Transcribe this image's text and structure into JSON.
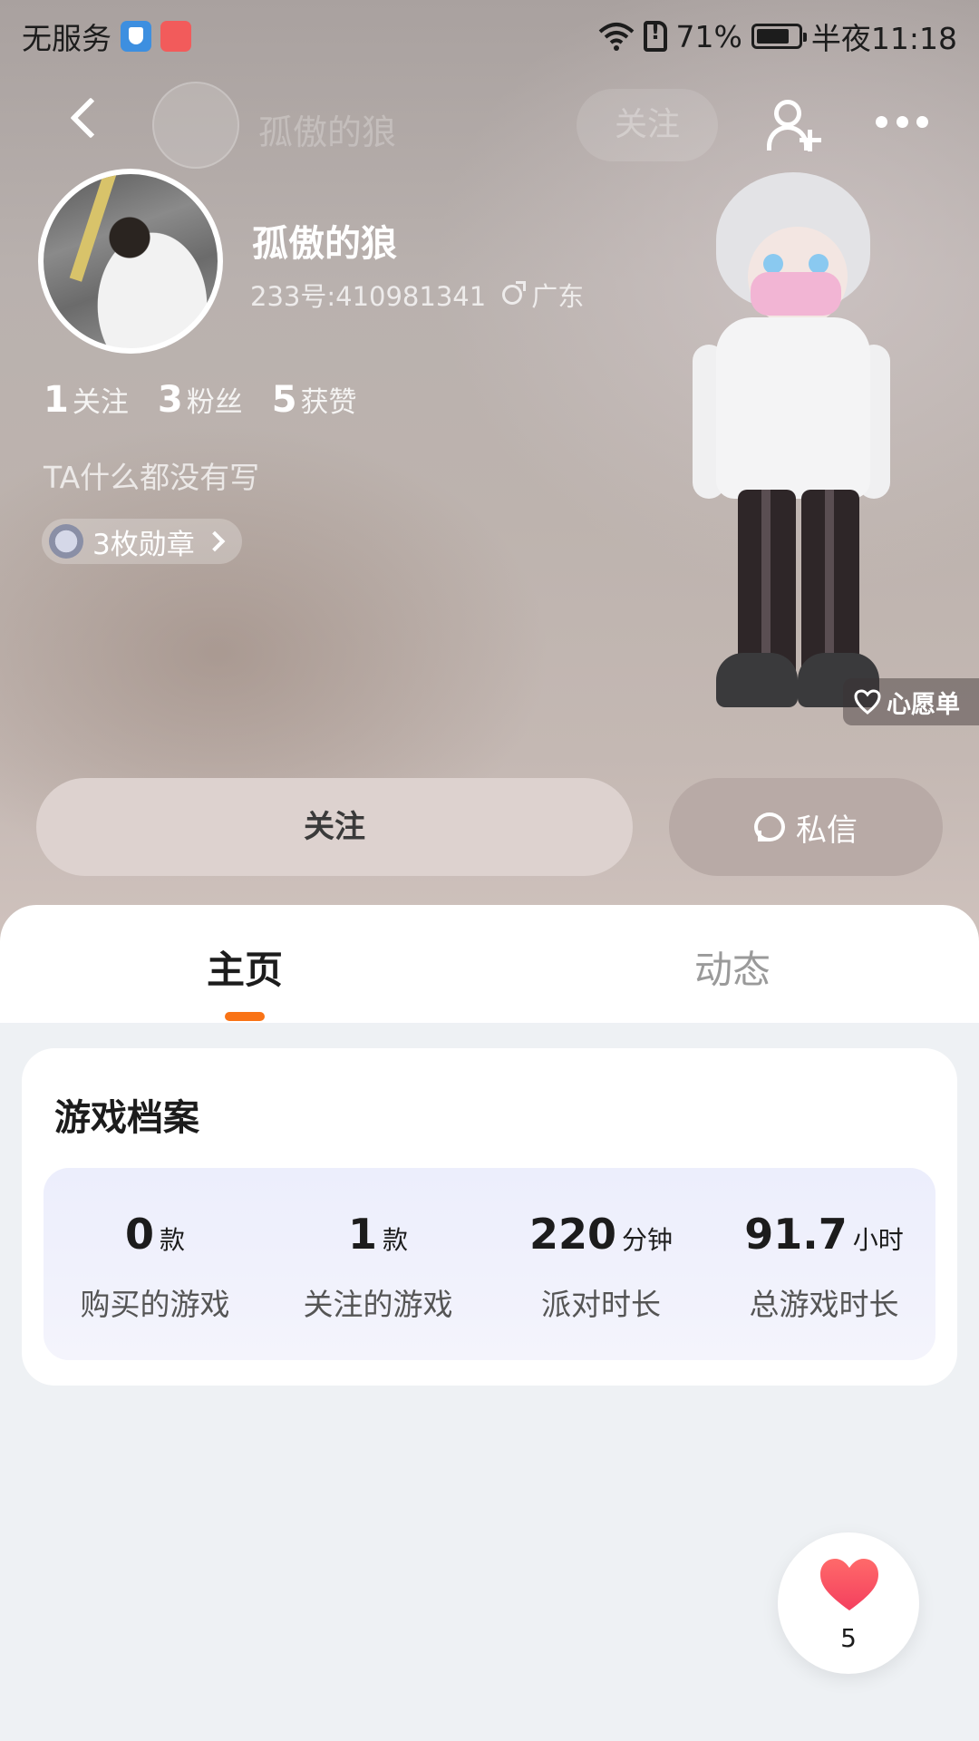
{
  "status_bar": {
    "carrier_text": "无服务",
    "battery_percent": "71%",
    "time": "半夜11:18",
    "icons": [
      "shield-icon",
      "app-badge-icon",
      "wifi-icon",
      "sim-alert-icon",
      "battery-icon"
    ]
  },
  "nav": {
    "collapsed_name": "孤傲的狼",
    "collapsed_follow": "关注",
    "icons": [
      "back-icon",
      "add-friend-icon",
      "more-icon"
    ]
  },
  "profile": {
    "name": "孤傲的狼",
    "id_text": "233号:410981341",
    "location": "广东",
    "stats": [
      {
        "num": "1",
        "label": "关注"
      },
      {
        "num": "3",
        "label": "粉丝"
      },
      {
        "num": "5",
        "label": "获赞"
      }
    ],
    "bio": "TA什么都没有写",
    "medals": "3枚勋章",
    "wishlist": "心愿单"
  },
  "actions": {
    "follow": "关注",
    "message": "私信"
  },
  "tabs": [
    {
      "label": "主页",
      "active": true
    },
    {
      "label": "动态",
      "active": false
    }
  ],
  "game_profile": {
    "title": "游戏档案",
    "items": [
      {
        "value": "0",
        "unit": "款",
        "label": "购买的游戏"
      },
      {
        "value": "1",
        "unit": "款",
        "label": "关注的游戏"
      },
      {
        "value": "220",
        "unit": "分钟",
        "label": "派对时长"
      },
      {
        "value": "91.7",
        "unit": "小时",
        "label": "总游戏时长"
      }
    ]
  },
  "like": {
    "count": "5"
  },
  "colors": {
    "accent": "#f97316",
    "like": "#f43f5e"
  }
}
